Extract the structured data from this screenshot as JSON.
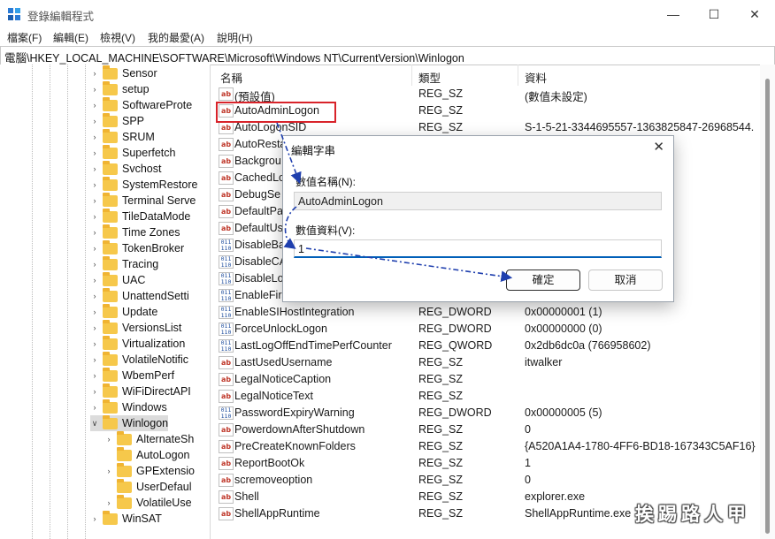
{
  "window": {
    "title": "登錄編輯程式",
    "minimize": "—",
    "maximize": "☐",
    "close": "✕"
  },
  "menu": [
    "檔案(F)",
    "編輯(E)",
    "檢視(V)",
    "我的最愛(A)",
    "說明(H)"
  ],
  "address": "電腦\\HKEY_LOCAL_MACHINE\\SOFTWARE\\Microsoft\\Windows NT\\CurrentVersion\\Winlogon",
  "tree": [
    {
      "label": "Sensor"
    },
    {
      "label": "setup"
    },
    {
      "label": "SoftwareProte"
    },
    {
      "label": "SPP"
    },
    {
      "label": "SRUM"
    },
    {
      "label": "Superfetch"
    },
    {
      "label": "Svchost"
    },
    {
      "label": "SystemRestore"
    },
    {
      "label": "Terminal Serve"
    },
    {
      "label": "TileDataMode"
    },
    {
      "label": "Time Zones"
    },
    {
      "label": "TokenBroker"
    },
    {
      "label": "Tracing"
    },
    {
      "label": "UAC"
    },
    {
      "label": "UnattendSetti"
    },
    {
      "label": "Update"
    },
    {
      "label": "VersionsList"
    },
    {
      "label": "Virtualization"
    },
    {
      "label": "VolatileNotific"
    },
    {
      "label": "WbemPerf"
    },
    {
      "label": "WiFiDirectAPI"
    },
    {
      "label": "Windows"
    },
    {
      "label": "Winlogon"
    },
    {
      "label": "AlternateSh"
    },
    {
      "label": "AutoLogon"
    },
    {
      "label": "GPExtensio"
    },
    {
      "label": "UserDefaul"
    },
    {
      "label": "VolatileUse"
    },
    {
      "label": "WinSAT"
    }
  ],
  "columns": {
    "name": "名稱",
    "type": "類型",
    "data": "資料"
  },
  "values": [
    {
      "icon": "ab",
      "name": "(預設值)",
      "type": "REG_SZ",
      "data": "(數值未設定)"
    },
    {
      "icon": "ab",
      "name": "AutoAdminLogon",
      "type": "REG_SZ",
      "data": ""
    },
    {
      "icon": "ab",
      "name": "AutoLogonSID",
      "type": "REG_SZ",
      "data": "S-1-5-21-3344695557-1363825847-26968544."
    },
    {
      "icon": "ab",
      "name": "AutoResta",
      "type": "",
      "data": ""
    },
    {
      "icon": "ab",
      "name": "Backgrou",
      "type": "",
      "data": ""
    },
    {
      "icon": "ab",
      "name": "CachedLo",
      "type": "",
      "data": ""
    },
    {
      "icon": "ab",
      "name": "DebugSe",
      "type": "",
      "data": ""
    },
    {
      "icon": "ab",
      "name": "DefaultPa",
      "type": "",
      "data": ""
    },
    {
      "icon": "ab",
      "name": "DefaultUs",
      "type": "",
      "data": ""
    },
    {
      "icon": "bin",
      "name": "DisableBa",
      "type": "",
      "data": ""
    },
    {
      "icon": "bin",
      "name": "DisableCA",
      "type": "",
      "data": ""
    },
    {
      "icon": "bin",
      "name": "DisableLo",
      "type": "",
      "data": ""
    },
    {
      "icon": "bin",
      "name": "EnableFirs",
      "type": "",
      "data": ""
    },
    {
      "icon": "bin",
      "name": "EnableSIHostIntegration",
      "type": "REG_DWORD",
      "data": "0x00000001 (1)"
    },
    {
      "icon": "bin",
      "name": "ForceUnlockLogon",
      "type": "REG_DWORD",
      "data": "0x00000000 (0)"
    },
    {
      "icon": "bin",
      "name": "LastLogOffEndTimePerfCounter",
      "type": "REG_QWORD",
      "data": "0x2db6dc0a (766958602)"
    },
    {
      "icon": "ab",
      "name": "LastUsedUsername",
      "type": "REG_SZ",
      "data": "itwalker"
    },
    {
      "icon": "ab",
      "name": "LegalNoticeCaption",
      "type": "REG_SZ",
      "data": ""
    },
    {
      "icon": "ab",
      "name": "LegalNoticeText",
      "type": "REG_SZ",
      "data": ""
    },
    {
      "icon": "bin",
      "name": "PasswordExpiryWarning",
      "type": "REG_DWORD",
      "data": "0x00000005 (5)"
    },
    {
      "icon": "ab",
      "name": "PowerdownAfterShutdown",
      "type": "REG_SZ",
      "data": "0"
    },
    {
      "icon": "ab",
      "name": "PreCreateKnownFolders",
      "type": "REG_SZ",
      "data": "{A520A1A4-1780-4FF6-BD18-167343C5AF16}"
    },
    {
      "icon": "ab",
      "name": "ReportBootOk",
      "type": "REG_SZ",
      "data": "1"
    },
    {
      "icon": "ab",
      "name": "scremoveoption",
      "type": "REG_SZ",
      "data": "0"
    },
    {
      "icon": "ab",
      "name": "Shell",
      "type": "REG_SZ",
      "data": "explorer.exe"
    },
    {
      "icon": "ab",
      "name": "ShellAppRuntime",
      "type": "REG_SZ",
      "data": "ShellAppRuntime.exe"
    }
  ],
  "dialog": {
    "title": "編輯字串",
    "name_label": "數值名稱(N):",
    "name_value": "AutoAdminLogon",
    "data_label": "數值資料(V):",
    "data_value": "1",
    "ok": "確定",
    "cancel": "取消",
    "close": "✕"
  },
  "watermark": "挨踢路人甲",
  "colors": {
    "highlight": "#d8232a",
    "arrow": "#1f3fae",
    "focus": "#005fb8"
  }
}
